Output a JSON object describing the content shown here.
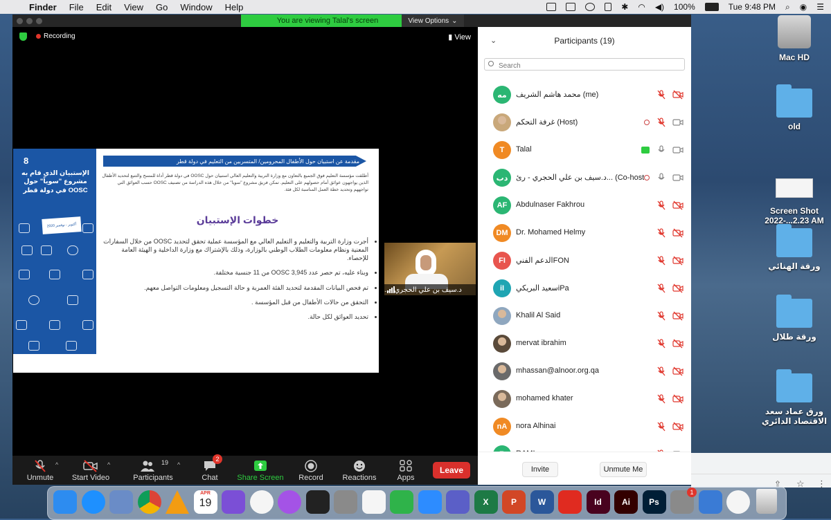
{
  "menubar": {
    "app": "Finder",
    "items": [
      "File",
      "Edit",
      "View",
      "Go",
      "Window",
      "Help"
    ],
    "battery": "100%",
    "clock": "Tue 9:48 PM"
  },
  "zoom": {
    "viewing_banner": "You are viewing Talal's screen",
    "view_options": "View Options",
    "recording": "Recording",
    "view_button": "View",
    "slide": {
      "number": "8",
      "side_title": "الإستبيان الذي قام به مشروع \"سوياً\" حول OOSC في دولة قطر",
      "badge": "أكتوبر - نوفمبر 2020",
      "header": "مقدمة عن استبيان حول الأطفال المحرومين/ المتسربين من التعليم في دولة قطر",
      "intro": "أطلقت مؤسسة التعليم فوق الجميع بالتعاون مع وزارة التربية والتعليم العالي استبيان حول OOSC في دولة قطر أداة للمسح والتتبع لتحديد الأطفال الذين يواجهون عوائق أمام حصولهم على التعليم. تمكن فريق مشروع \"سويا\" من خلال هذه الدراسة من تصنيف OOSC حسب العوائق التي تواجههم وتحديد خطة العمل المناسبة لكل فئة.",
      "title": "خطوات الإستبيان",
      "bullets": [
        "أجرت وزارة التربية والتعليم و التعليم العالي مع المؤسسة عملية تحقق لتحديد OOSC من خلال السفارات المعنية ونظام معلومات الطلاب الوطني بالوزارة، وذلك بالإشتراك مع وزارة الداخلية و الهيئة العامة للإحصاء.",
        "وبناء عليه، تم حصر عدد 3,945 OOSC من 11 جنسية مختلفة.",
        "تم فحص البيانات المقدمة لتحديد الفئة العمرية و حالة التسجيل ومعلومات التواصل معهم.",
        "التحقق من حالات الأطفال من قبل المؤسسة .",
        "تحديد العوائق لكل حالة."
      ]
    },
    "speaker": {
      "name": "د.سيف بن علي الحجري -..."
    },
    "toolbar": {
      "unmute": "Unmute",
      "start_video": "Start Video",
      "participants": "Participants",
      "participants_count": "19",
      "chat": "Chat",
      "chat_badge": "2",
      "share": "Share Screen",
      "record": "Record",
      "reactions": "Reactions",
      "apps": "Apps",
      "leave": "Leave"
    },
    "panel": {
      "title": "Participants (19)",
      "search_placeholder": "Search",
      "invite": "Invite",
      "unmute_me": "Unmute Me",
      "participants": [
        {
          "initials": "مه",
          "name": "محمد هاشم الشريف (me)",
          "color": "#2bb673",
          "photo": false,
          "rec": false,
          "share": false,
          "mic": "muted",
          "cam": "off"
        },
        {
          "initials": "",
          "name": "غرفة  التحكم (Host)",
          "color": "#c9a87a",
          "photo": true,
          "rec": true,
          "share": false,
          "mic": "muted",
          "cam": "on"
        },
        {
          "initials": "T",
          "name": "Talal",
          "color": "#f08a24",
          "photo": false,
          "rec": false,
          "share": true,
          "mic": "on",
          "cam": "on"
        },
        {
          "initials": "دب",
          "name": "د.سيف بن علي الحجري - رئ... (Co-host)",
          "color": "#2bb673",
          "photo": false,
          "rec": true,
          "share": false,
          "mic": "on",
          "cam": "on"
        },
        {
          "initials": "AF",
          "name": "Abdulnaser Fakhrou",
          "color": "#2bb673",
          "photo": false,
          "rec": false,
          "share": false,
          "mic": "muted",
          "cam": "off"
        },
        {
          "initials": "DM",
          "name": "Dr. Mohamed Helmy",
          "color": "#f08a24",
          "photo": false,
          "rec": false,
          "share": false,
          "mic": "muted",
          "cam": "off"
        },
        {
          "initials": "FI",
          "name": "الدعم الفنيFON",
          "color": "#e8554e",
          "photo": false,
          "rec": false,
          "share": false,
          "mic": "muted",
          "cam": "off"
        },
        {
          "initials": "iI",
          "name": "سعيد البريكيiPa",
          "color": "#1fa5b3",
          "photo": false,
          "rec": false,
          "share": false,
          "mic": "muted",
          "cam": "off"
        },
        {
          "initials": "",
          "name": "Khalil Al Said",
          "color": "#8fa7bf",
          "photo": true,
          "rec": false,
          "share": false,
          "mic": "muted",
          "cam": "off"
        },
        {
          "initials": "",
          "name": "mervat ibrahim",
          "color": "#5a4a3a",
          "photo": true,
          "rec": false,
          "share": false,
          "mic": "muted",
          "cam": "off"
        },
        {
          "initials": "",
          "name": "mhassan@alnoor.org.qa",
          "color": "#6a6a6a",
          "photo": true,
          "rec": false,
          "share": false,
          "mic": "muted",
          "cam": "off"
        },
        {
          "initials": "",
          "name": "mohamed khater",
          "color": "#7a6a5a",
          "photo": true,
          "rec": false,
          "share": false,
          "mic": "muted",
          "cam": "off"
        },
        {
          "initials": "nA",
          "name": "nora Alhinai",
          "color": "#f08a24",
          "photo": false,
          "rec": false,
          "share": false,
          "mic": "muted",
          "cam": "off"
        },
        {
          "initials": "R",
          "name": "RAMI",
          "color": "#2bb673",
          "photo": false,
          "rec": false,
          "share": false,
          "mic": "muted",
          "cam": "on"
        }
      ]
    }
  },
  "desktop": {
    "icons": [
      {
        "label": "Mac HD",
        "kind": "hd"
      },
      {
        "label": "old",
        "kind": "folder"
      },
      {
        "label": "Screen Shot 2022-...2.23 AM",
        "kind": "shot"
      },
      {
        "label": "ورقة الهنائي",
        "kind": "folder"
      },
      {
        "label": "ورقة طلال",
        "kind": "folder"
      },
      {
        "label": "ورق عماد سعد الاقتصاد الدائري",
        "kind": "folder"
      }
    ]
  },
  "dock": {
    "calendar_month": "APR",
    "calendar_day": "19",
    "settings_badge": "1",
    "apps": [
      {
        "name": "Finder",
        "color": "#2d8cf0",
        "label": ""
      },
      {
        "name": "Safari",
        "color": "#1e90ff",
        "label": ""
      },
      {
        "name": "Preview",
        "color": "#6a8cc7",
        "label": ""
      },
      {
        "name": "Chrome",
        "color": "#e8e8e8",
        "label": ""
      },
      {
        "name": "VLC",
        "color": "#f39c12",
        "label": ""
      },
      {
        "name": "Calendar",
        "color": "#ffffff",
        "label": ""
      },
      {
        "name": "iMovie",
        "color": "#7b4fd6",
        "label": ""
      },
      {
        "name": "Photos",
        "color": "#f5f5f5",
        "label": ""
      },
      {
        "name": "Podcasts",
        "color": "#a453e6",
        "label": ""
      },
      {
        "name": "Apple TV",
        "color": "#222222",
        "label": ""
      },
      {
        "name": "Calculator",
        "color": "#8a8a8a",
        "label": ""
      },
      {
        "name": "TextEdit",
        "color": "#f5f5f5",
        "label": ""
      },
      {
        "name": "Numbers",
        "color": "#2fb34a",
        "label": ""
      },
      {
        "name": "Zoom",
        "color": "#2d8cff",
        "label": ""
      },
      {
        "name": "Teams",
        "color": "#5b5fc7",
        "label": ""
      },
      {
        "name": "Excel",
        "color": "#1d7a45",
        "label": "X"
      },
      {
        "name": "PowerPoint",
        "color": "#d24726",
        "label": "P"
      },
      {
        "name": "Word",
        "color": "#2b579a",
        "label": "W"
      },
      {
        "name": "Acrobat",
        "color": "#e02b20",
        "label": ""
      },
      {
        "name": "InDesign",
        "color": "#49021f",
        "label": "Id"
      },
      {
        "name": "Illustrator",
        "color": "#330000",
        "label": "Ai"
      },
      {
        "name": "Photoshop",
        "color": "#001e36",
        "label": "Ps"
      },
      {
        "name": "System Preferences",
        "color": "#8a8a8a",
        "label": ""
      },
      {
        "name": "Blue app",
        "color": "#3a7bd5",
        "label": ""
      },
      {
        "name": "Music",
        "color": "#f5f5f5",
        "label": ""
      }
    ]
  },
  "colors": {
    "accent": "#2d8cff",
    "leave": "#d9302c",
    "share_green": "#2ecc40",
    "slide_blue": "#1b56a5",
    "slide_title": "#5b3c99",
    "muted_red": "#e0352b"
  }
}
